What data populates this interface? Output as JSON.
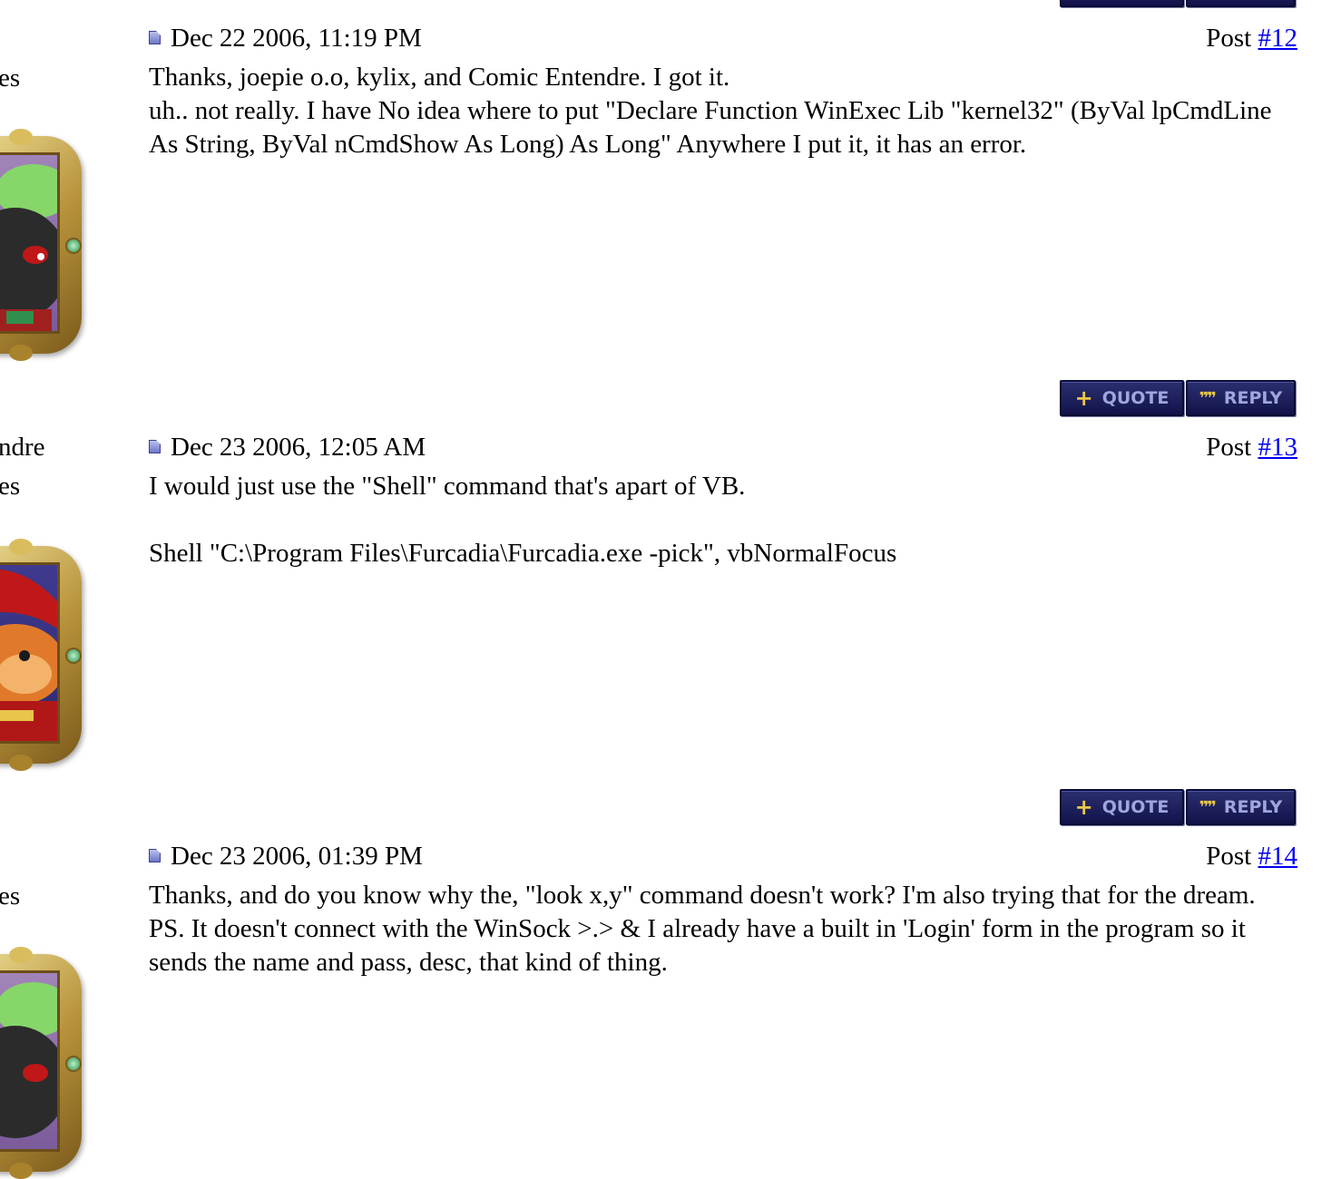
{
  "buttons": {
    "quote_label": "QUOTE",
    "reply_label": "REPLY"
  },
  "posts": [
    {
      "side_lines": [
        "es"
      ],
      "date": "Dec 22 2006, 11:19 PM",
      "post_prefix": "Post",
      "post_number": "#12",
      "lines": [
        "Thanks, joepie o.o, kylix, and Comic Entendre. I got it.",
        "uh.. not really. I have No idea where to put \"Declare Function WinExec Lib \"kernel32\" (ByVal lpCmdLine As String, ByVal nCmdShow As Long) As Long\" Anywhere I put it, it has an error."
      ]
    },
    {
      "side_lines": [
        "ndre",
        "es"
      ],
      "date": "Dec 23 2006, 12:05 AM",
      "post_prefix": "Post",
      "post_number": "#13",
      "lines": [
        "I would just use the \"Shell\" command that's apart of VB.",
        "",
        "Shell \"C:\\Program Files\\Furcadia\\Furcadia.exe -pick\", vbNormalFocus"
      ]
    },
    {
      "side_lines": [
        "es"
      ],
      "date": "Dec 23 2006, 01:39 PM",
      "post_prefix": "Post",
      "post_number": "#14",
      "lines": [
        "Thanks, and do you know why the, \"look x,y\" command doesn't work? I'm also trying that for the dream.",
        "PS. It doesn't connect with the WinSock >.> & I already have a built in 'Login' form in the program so it sends the name and pass, desc, that kind of thing."
      ]
    }
  ]
}
